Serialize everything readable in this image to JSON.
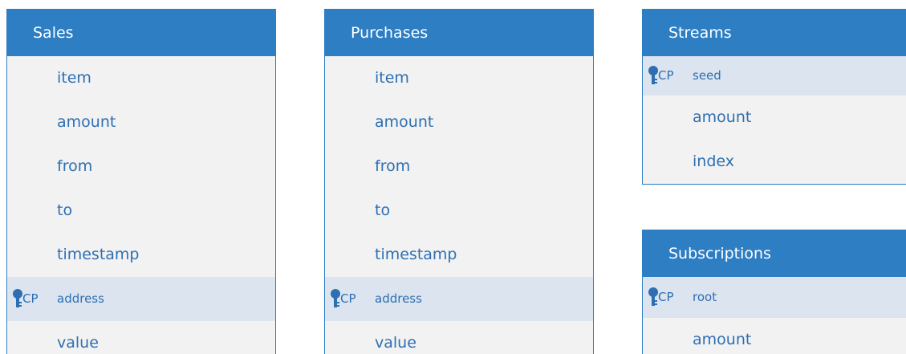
{
  "entities": [
    {
      "title": "Sales",
      "fields": [
        {
          "name": "item",
          "key": false
        },
        {
          "name": "amount",
          "key": false
        },
        {
          "name": "from",
          "key": false
        },
        {
          "name": "to",
          "key": false
        },
        {
          "name": "timestamp",
          "key": false
        },
        {
          "name": "address",
          "key": true,
          "tag": "CP"
        },
        {
          "name": "value",
          "key": false
        }
      ]
    },
    {
      "title": "Purchases",
      "fields": [
        {
          "name": "item",
          "key": false
        },
        {
          "name": "amount",
          "key": false
        },
        {
          "name": "from",
          "key": false
        },
        {
          "name": "to",
          "key": false
        },
        {
          "name": "timestamp",
          "key": false
        },
        {
          "name": "address",
          "key": true,
          "tag": "CP"
        },
        {
          "name": "value",
          "key": false
        }
      ]
    },
    {
      "title": "Streams",
      "fields": [
        {
          "name": "seed",
          "key": true,
          "tag": "CP"
        },
        {
          "name": "amount",
          "key": false
        },
        {
          "name": "index",
          "key": false
        }
      ]
    },
    {
      "title": "Subscriptions",
      "fields": [
        {
          "name": "root",
          "key": true,
          "tag": "CP"
        },
        {
          "name": "amount",
          "key": false
        }
      ]
    }
  ],
  "colors": {
    "header": "#2e7ec4",
    "body": "#f2f2f2",
    "key_row": "#dce4ef",
    "text": "#2e6fb2"
  },
  "icons": {
    "key": "key-icon"
  }
}
